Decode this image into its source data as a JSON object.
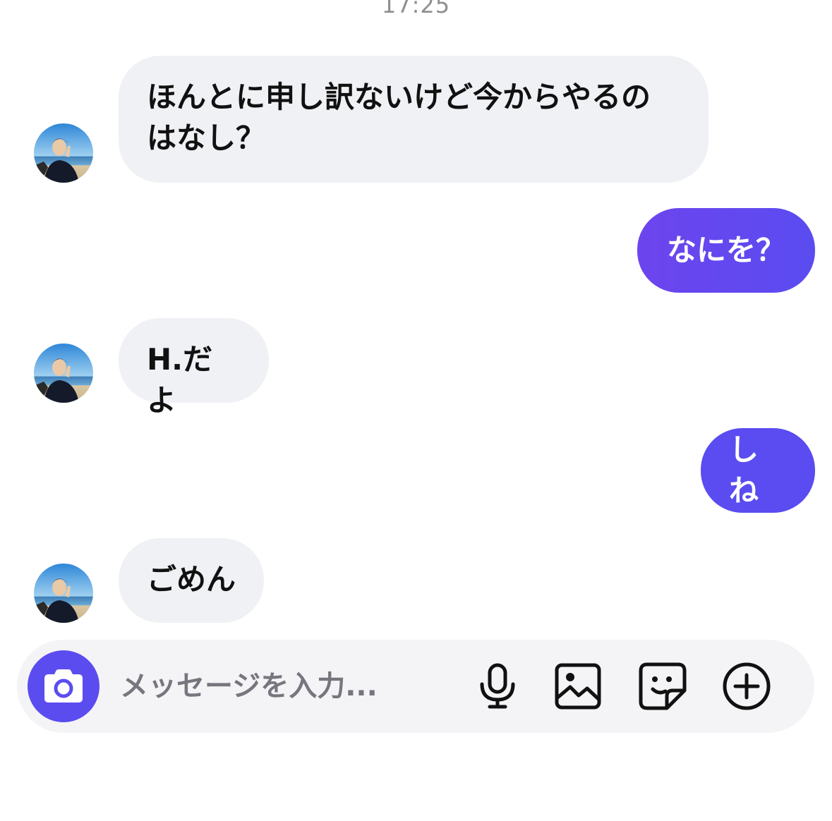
{
  "header": {
    "timestamp": "17:25"
  },
  "messages": [
    {
      "direction": "incoming",
      "text": "ほんとに申し訳ないけど今からやるの\nはなし？"
    },
    {
      "direction": "outgoing",
      "text": "なにを？"
    },
    {
      "direction": "incoming",
      "text": "H.だよ"
    },
    {
      "direction": "outgoing",
      "text": "しね"
    },
    {
      "direction": "incoming",
      "text": "ごめん"
    }
  ],
  "composer": {
    "placeholder": "メッセージを入力...",
    "icons": [
      "camera-icon",
      "microphone-icon",
      "image-icon",
      "sticker-icon",
      "plus-circle-icon"
    ]
  },
  "colors": {
    "accent": "#5b4cf0",
    "outgoing_bubble_gradient": [
      "#6d44ee",
      "#5a4cf0"
    ],
    "incoming_bubble": "#f0f1f5",
    "placeholder_text": "#76767f"
  }
}
